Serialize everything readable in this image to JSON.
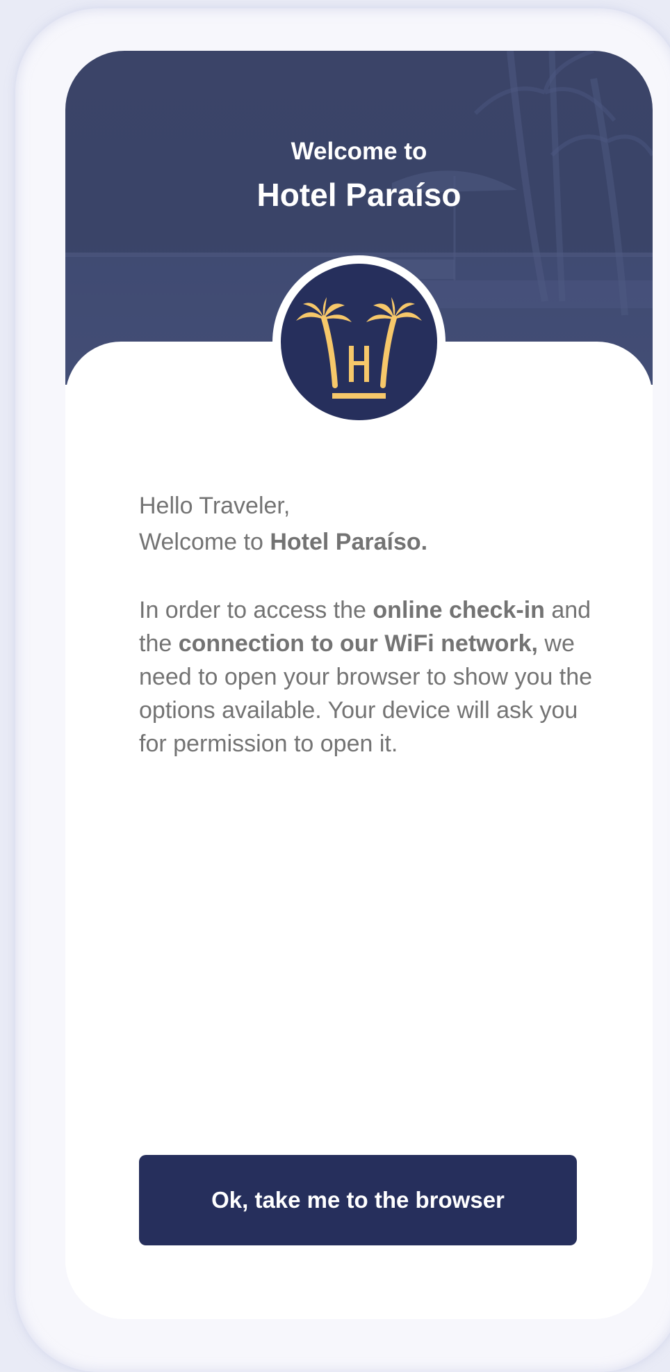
{
  "header": {
    "subtitle": "Welcome to",
    "title": "Hotel Paraíso"
  },
  "greeting": {
    "line1": "Hello Traveler,",
    "line2_prefix": "Welcome to ",
    "line2_hotel": "Hotel Paraíso."
  },
  "body": {
    "part1": "In order to access the ",
    "bold1": "online check-in",
    "part2": " and the ",
    "bold2": "connection to our WiFi network,",
    "part3": " we need to open your browser to show you the options available. Your device will ask you for permission to open it."
  },
  "button": {
    "label": "Ok, take me to the browser"
  },
  "colors": {
    "brand_navy": "#262f5c",
    "accent_gold": "#f7c86a",
    "text_gray": "#737373"
  },
  "icons": {
    "logo": "palm-trees-h-logo-icon"
  }
}
